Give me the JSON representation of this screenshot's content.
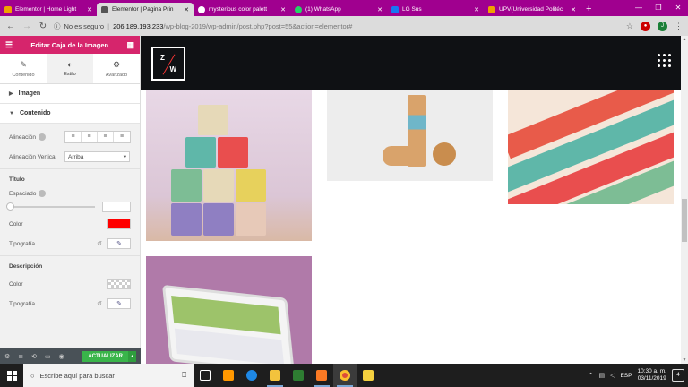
{
  "browser": {
    "tabs": [
      {
        "title": "Elementor | Home Light",
        "color": "#f0a000"
      },
      {
        "title": "Elementor | Pagina Prin",
        "color": "#555555"
      },
      {
        "title": "mysterious color palett",
        "color": "#4285f4"
      },
      {
        "title": "(1) WhatsApp",
        "color": "#25d366"
      },
      {
        "title": "LG Sus",
        "color": "#1877f2"
      },
      {
        "title": "UPV(Universidad Politéc",
        "color": "#f0a000"
      }
    ],
    "new_tab": "+",
    "window_controls": [
      "—",
      "❐",
      "✕"
    ],
    "security_label": "No es seguro",
    "url_host": "206.189.193.233",
    "url_path": "/wp-blog-2019/wp-admin/post.php?post=55&action=elementor#",
    "profile_letter": "J"
  },
  "panel": {
    "title": "Editar Caja de la Imagen",
    "tabs": [
      {
        "label": "Contenido",
        "icon": "✎"
      },
      {
        "label": "Estilo",
        "icon": "◐"
      },
      {
        "label": "Avanzado",
        "icon": "⚙"
      }
    ],
    "sections": {
      "imagen": "Imagen",
      "contenido": "Contenido"
    },
    "alignment_label": "Alineación",
    "vertical_alignment_label": "Alineación Vertical",
    "vertical_alignment_value": "Arriba",
    "titulo_heading": "Título",
    "espaciado_label": "Espaciado",
    "color_label": "Color",
    "typography_label": "Tipografía",
    "descripcion_heading": "Descripción",
    "desc_color_label": "Color",
    "desc_typography_label": "Tipografía",
    "title_color": "#ff0000",
    "update_button": "ACTUALIZAR"
  },
  "site": {
    "logo_top": "Z",
    "logo_bottom": "W"
  },
  "taskbar": {
    "search_placeholder": "Escribe aquí para buscar",
    "language": "ESP",
    "time": "10:30 a. m.",
    "date": "03/11/2019",
    "notifications": "4"
  }
}
